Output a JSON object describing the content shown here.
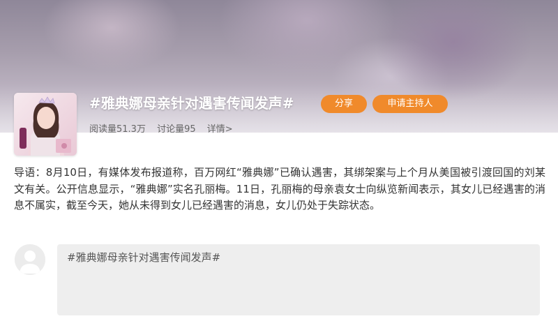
{
  "topic": {
    "title": "#雅典娜母亲针对遇害传闻发声#",
    "share_label": "分享",
    "apply_host_label": "申请主持人",
    "read_count": "阅读量51.3万",
    "discussion_count": "讨论量95",
    "details_label": "详情>"
  },
  "intro": {
    "text": "导语：8月10日，有媒体发布报道称，百万网红“雅典娜”已确认遇害，其绑架案与上个月从美国被引渡回国的刘某文有关。公开信息显示，“雅典娜”实名孔丽梅。11日，孔丽梅的母亲袁女士向纵览新闻表示，其女儿已经遇害的消息不属实，截至今天，她从未得到女儿已经遇害的消息，女儿仍处于失踪状态。"
  },
  "comment": {
    "placeholder": "#雅典娜母亲针对遇害传闻发声#"
  },
  "colors": {
    "accent": "#f08a2b",
    "comment_bg": "#eeeeee"
  },
  "icons": {
    "topic_avatar": "topic-avatar-image",
    "user_avatar": "default-user-icon"
  }
}
